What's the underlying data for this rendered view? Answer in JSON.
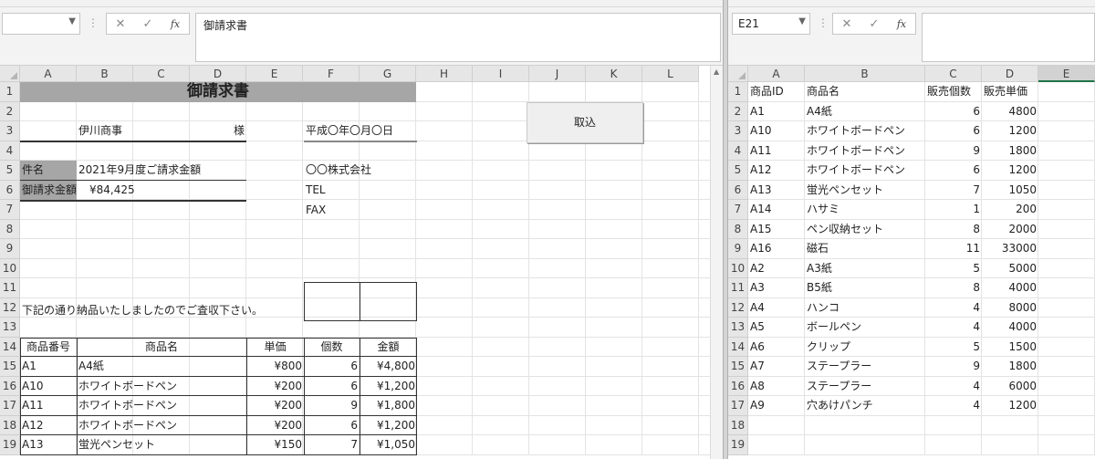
{
  "left": {
    "name_box": "",
    "formula_bar": "御請求書",
    "formula_icons": {
      "cancel": "✕",
      "confirm": "✓",
      "fx": "fx"
    },
    "columns": [
      "A",
      "B",
      "C",
      "D",
      "E",
      "F",
      "G",
      "H",
      "I",
      "J",
      "K",
      "L"
    ],
    "rows": [
      "1",
      "2",
      "3",
      "4",
      "5",
      "6",
      "7",
      "8",
      "9",
      "10",
      "11",
      "12",
      "13",
      "14",
      "15",
      "16",
      "17",
      "18",
      "19"
    ],
    "invoice": {
      "title": "御請求書",
      "customer": "伊川商事",
      "honorific": "様",
      "date": "平成〇年〇月〇日",
      "subject_label": "件名",
      "subject_value": "2021年9月度ご請求金額",
      "company": "〇〇株式会社",
      "amount_label": "御請求金額",
      "amount_value": "¥84,425",
      "tel": "TEL",
      "fax": "FAX",
      "note": "下記の通り納品いたしましたのでご査収下さい。",
      "headers": [
        "商品番号",
        "商品名",
        "単価",
        "個数",
        "金額"
      ],
      "items": [
        [
          "A1",
          "A4紙",
          "¥800",
          "6",
          "¥4,800"
        ],
        [
          "A10",
          "ホワイトボードペン",
          "¥200",
          "6",
          "¥1,200"
        ],
        [
          "A11",
          "ホワイトボードペン",
          "¥200",
          "9",
          "¥1,800"
        ],
        [
          "A12",
          "ホワイトボードペン",
          "¥200",
          "6",
          "¥1,200"
        ],
        [
          "A13",
          "蛍光ペンセット",
          "¥150",
          "7",
          "¥1,050"
        ]
      ]
    },
    "import_button": "取込"
  },
  "right": {
    "name_box": "E21",
    "formula_bar": "",
    "formula_icons": {
      "cancel": "✕",
      "confirm": "✓",
      "fx": "fx"
    },
    "columns": [
      "A",
      "B",
      "C",
      "D",
      "E"
    ],
    "rows": [
      "1",
      "2",
      "3",
      "4",
      "5",
      "6",
      "7",
      "8",
      "9",
      "10",
      "11",
      "12",
      "13",
      "14",
      "15",
      "16",
      "17",
      "18",
      "19"
    ],
    "headers": [
      "商品ID",
      "商品名",
      "販売個数",
      "販売単価"
    ],
    "items": [
      [
        "A1",
        "A4紙",
        "6",
        "4800"
      ],
      [
        "A10",
        "ホワイトボードペン",
        "6",
        "1200"
      ],
      [
        "A11",
        "ホワイトボードペン",
        "9",
        "1800"
      ],
      [
        "A12",
        "ホワイトボードペン",
        "6",
        "1200"
      ],
      [
        "A13",
        "蛍光ペンセット",
        "7",
        "1050"
      ],
      [
        "A14",
        "ハサミ",
        "1",
        "200"
      ],
      [
        "A15",
        "ペン収納セット",
        "8",
        "2000"
      ],
      [
        "A16",
        "磁石",
        "11",
        "33000"
      ],
      [
        "A2",
        "A3紙",
        "5",
        "5000"
      ],
      [
        "A3",
        "B5紙",
        "8",
        "4000"
      ],
      [
        "A4",
        "ハンコ",
        "4",
        "8000"
      ],
      [
        "A5",
        "ボールペン",
        "4",
        "4000"
      ],
      [
        "A6",
        "クリップ",
        "5",
        "1500"
      ],
      [
        "A7",
        "ステープラー",
        "9",
        "1800"
      ],
      [
        "A8",
        "ステープラー",
        "4",
        "6000"
      ],
      [
        "A9",
        "穴あけパンチ",
        "4",
        "1200"
      ]
    ]
  },
  "colors": {
    "title_fill": "#a6a6a6",
    "header_bg": "#e6e6e6",
    "selected_col": "#d2d2d2"
  }
}
